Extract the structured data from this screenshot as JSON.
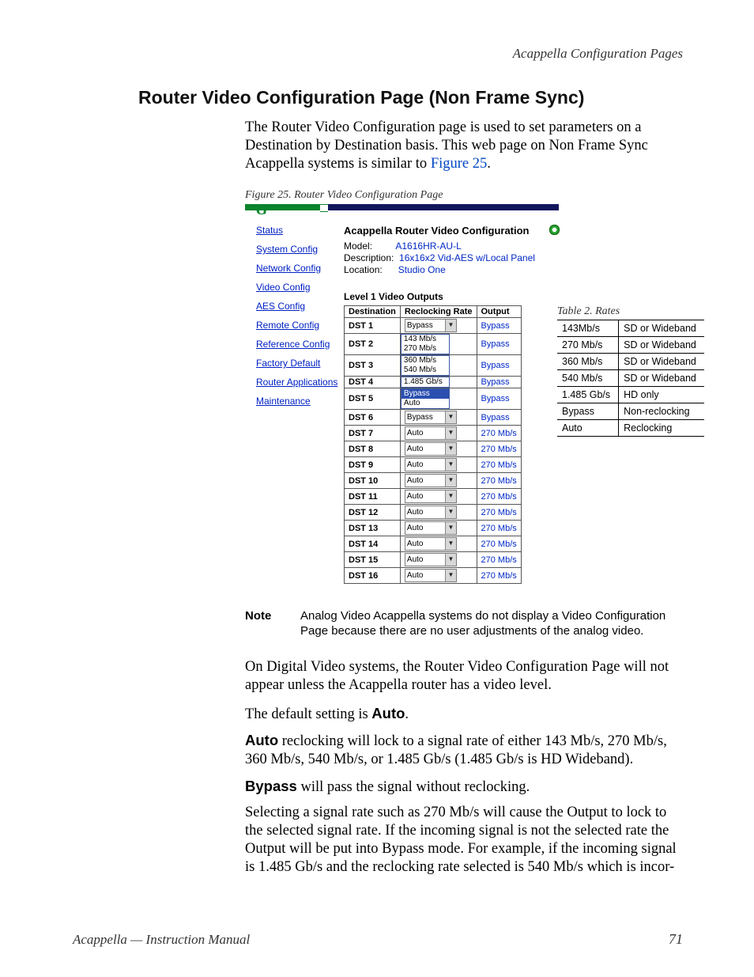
{
  "headerRight": "Acappella Configuration Pages",
  "title": "Router Video Configuration Page (Non Frame Sync)",
  "intro1": "The Router Video Configuration page is used to set parameters on a Destination by Destination basis. This web page on Non Frame Sync Acappella systems is similar to ",
  "figRef": "Figure 25",
  "period": ".",
  "figCaption": "Figure 25.  Router Video Configuration Page",
  "nav": {
    "status": "Status",
    "system": "System Config",
    "network": "Network Config",
    "video": "Video Config",
    "aes": "AES Config",
    "remote": "Remote Config",
    "reference": "Reference Config",
    "factory": "Factory Default",
    "apps": "Router Applications",
    "maint": "Maintenance"
  },
  "shot": {
    "heading": "Acappella Router Video Configuration",
    "modelLbl": "Model:",
    "modelVal": "A1616HR-AU-L",
    "descLbl": "Description:",
    "descVal": "16x16x2 Vid-AES w/Local Panel",
    "locLbl": "Location:",
    "locVal": "Studio One",
    "section": "Level 1 Video Outputs",
    "col1": "Destination",
    "col2": "Reclocking Rate",
    "col3": "Output",
    "rows": [
      {
        "dst": "DST 1",
        "rate": "Bypass",
        "out": "Bypass",
        "dd": true
      },
      {
        "dst": "DST 2",
        "open": [
          "143 Mb/s",
          "270 Mb/s"
        ],
        "out": "Bypass"
      },
      {
        "dst": "DST 3",
        "open": [
          "360 Mb/s",
          "540 Mb/s"
        ],
        "out": "Bypass"
      },
      {
        "dst": "DST 4",
        "open": [
          "1.485 Gb/s"
        ],
        "out": "Bypass"
      },
      {
        "dst": "DST 5",
        "open": [
          "Bypass",
          "Auto"
        ],
        "hl": "Bypass",
        "out": "Bypass"
      },
      {
        "dst": "DST 6",
        "rate": "Bypass",
        "out": "Bypass",
        "dd": true
      },
      {
        "dst": "DST 7",
        "rate": "Auto",
        "out": "270 Mb/s",
        "dd": true
      },
      {
        "dst": "DST 8",
        "rate": "Auto",
        "out": "270 Mb/s",
        "dd": true
      },
      {
        "dst": "DST 9",
        "rate": "Auto",
        "out": "270 Mb/s",
        "dd": true
      },
      {
        "dst": "DST 10",
        "rate": "Auto",
        "out": "270 Mb/s",
        "dd": true
      },
      {
        "dst": "DST 11",
        "rate": "Auto",
        "out": "270 Mb/s",
        "dd": true
      },
      {
        "dst": "DST 12",
        "rate": "Auto",
        "out": "270 Mb/s",
        "dd": true
      },
      {
        "dst": "DST 13",
        "rate": "Auto",
        "out": "270 Mb/s",
        "dd": true
      },
      {
        "dst": "DST 14",
        "rate": "Auto",
        "out": "270 Mb/s",
        "dd": true
      },
      {
        "dst": "DST 15",
        "rate": "Auto",
        "out": "270 Mb/s",
        "dd": true
      },
      {
        "dst": "DST 16",
        "rate": "Auto",
        "out": "270 Mb/s",
        "dd": true
      }
    ]
  },
  "ratesCaption": "Table 2.  Rates",
  "rates": [
    [
      "143Mb/s",
      "SD or Wideband"
    ],
    [
      "270 Mb/s",
      "SD or Wideband"
    ],
    [
      "360 Mb/s",
      "SD or Wideband"
    ],
    [
      "540 Mb/s",
      "SD or Wideband"
    ],
    [
      "1.485 Gb/s",
      "HD only"
    ],
    [
      "Bypass",
      "Non-reclocking"
    ],
    [
      "Auto",
      "Reclocking"
    ]
  ],
  "noteLbl": "Note",
  "noteTxt": "Analog Video Acappella systems do not display a Video Configuration Page because there are no user adjustments of the analog video.",
  "p2": "On Digital Video systems, the Router Video Configuration Page will not appear unless the Acappella router has a video level.",
  "p3a": "The default setting is ",
  "p3b": "Auto",
  "p4a": "Auto",
  "p4b": " reclocking will lock to a signal rate of either 143 Mb/s, 270 Mb/s, 360 Mb/s, 540 Mb/s, or 1.485 Gb/s (1.485 Gb/s is HD Wideband).",
  "p5a": "Bypass",
  "p5b": " will pass the signal without reclocking.",
  "p6": "Selecting a signal rate such as 270 Mb/s will cause the Output to lock to the selected signal rate. If the incoming signal is not the selected rate the Output will be put into Bypass mode. For example, if the incoming signal is 1.485 Gb/s and the reclocking rate selected is 540 Mb/s which is incor-",
  "footerLeft": "Acappella  —  Instruction Manual",
  "footerRight": "71"
}
